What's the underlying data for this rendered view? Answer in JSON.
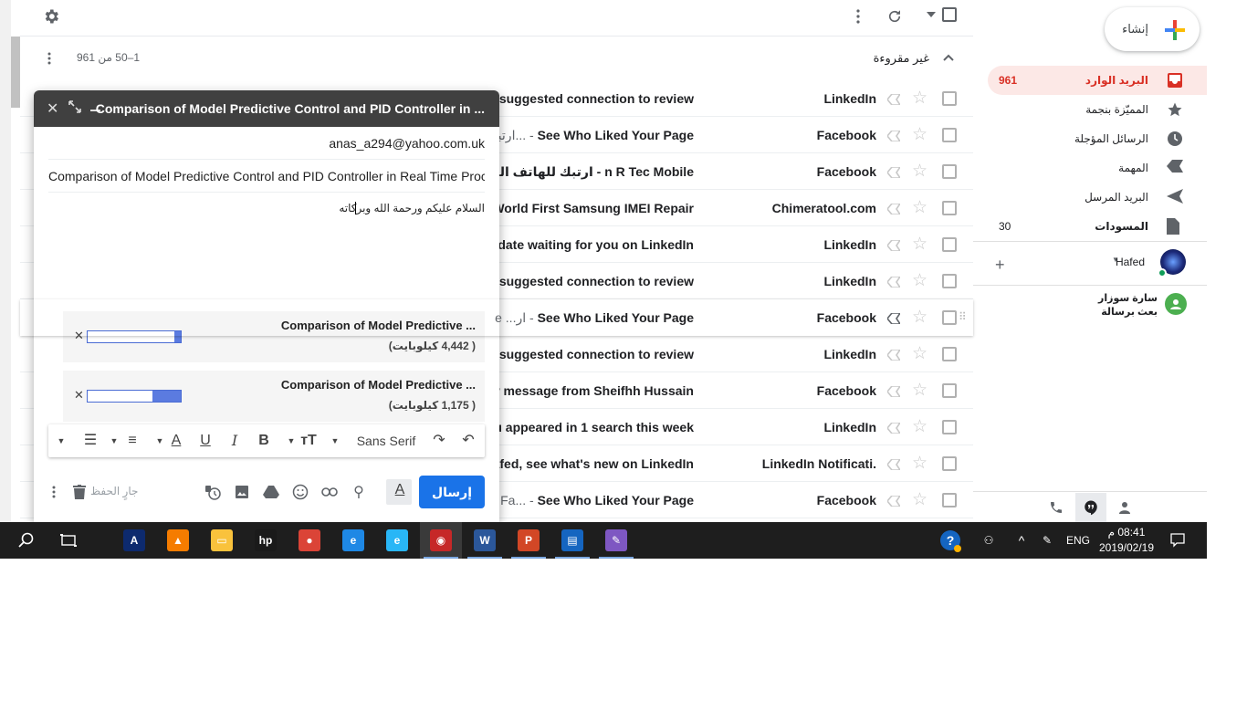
{
  "toolbar": {
    "settings_icon": "gear-icon",
    "more_icon": "more-vert-icon",
    "refresh_icon": "refresh-icon",
    "select_icon": "checkbox-icon"
  },
  "section": {
    "title": "غير مقروءة",
    "pagination": "1–50 من 961"
  },
  "emails": [
    {
      "sender": "LinkedIn",
      "subject": "w suggested connection to review",
      "snippet": ""
    },
    {
      "sender": "Facebook",
      "subject": "See Who Liked Your Page",
      "snippet": "ارتبك لـ... - "
    },
    {
      "sender": "Facebook",
      "subject": "ارتبك للهاتف المحمول - n R Tec Mobile",
      "snippet": ""
    },
    {
      "sender": "Chimeratool.com",
      "subject": "World First Samsung IMEI Repair",
      "snippet": ""
    },
    {
      "sender": "LinkedIn",
      "subject": "pdate waiting for you on LinkedIn",
      "snippet": ""
    },
    {
      "sender": "LinkedIn",
      "subject": "w suggested connection to review",
      "snippet": ""
    },
    {
      "sender": "Facebook",
      "subject": "See Who Liked Your Page",
      "snippet": "e ...ار - "
    },
    {
      "sender": "LinkedIn",
      "subject": "w suggested connection to review",
      "snippet": ""
    },
    {
      "sender": "Facebook",
      "subject": "w message from Sheifhh Hussain",
      "snippet": ""
    },
    {
      "sender": "LinkedIn",
      "subject": "u appeared in 1 search this week",
      "snippet": ""
    },
    {
      "sender": "LinkedIn Notificati.",
      "subject": "afed, see what's new on LinkedIn",
      "snippet": ""
    },
    {
      "sender": "Facebook",
      "subject": "See Who Liked Your Page",
      "snippet": "!ا. Fa... - "
    }
  ],
  "sidebar": {
    "compose_label": "إنشاء",
    "items": [
      {
        "label": "البريد الوارد",
        "count": "961",
        "icon": "inbox-icon"
      },
      {
        "label": "المميّزة بنجمة",
        "count": "",
        "icon": "star-icon"
      },
      {
        "label": "الرسائل المؤجلة",
        "count": "",
        "icon": "clock-icon"
      },
      {
        "label": "المهمة",
        "count": "",
        "icon": "important-icon"
      },
      {
        "label": "البريد المرسل",
        "count": "",
        "icon": "send-icon"
      },
      {
        "label": "المسودات",
        "count": "30",
        "icon": "draft-icon"
      }
    ],
    "hangouts_user": "Hafed",
    "contact_name": "سارة سوزار",
    "contact_status": "بعث برسالة"
  },
  "compose": {
    "title": "Comparison of Model Predictive Control and PID Controller in ...",
    "to": "anas_a294@yahoo.com.uk",
    "subject": "Comparison of Model Predictive Control and PID Controller in Real Time Proc",
    "body": "السلام عليكم ورحمة الله وبركاته",
    "attachments": [
      {
        "name": "Comparison of Model Predictive ...",
        "size": "( 4,442 كيلوبايت)",
        "progress": 0.07
      },
      {
        "name": "Comparison of Model Predictive ...",
        "size": "( 1,175 كيلوبايت)",
        "progress": 0.3
      }
    ],
    "font": "Sans Serif",
    "send_label": "إرسال",
    "saving_label": "جارٍ الحفظ"
  },
  "taskbar": {
    "language": "ENG",
    "time": "08:41 م",
    "date": "2019/02/19",
    "apps": [
      "autodesk-icon",
      "vlc-icon",
      "file-explorer-icon",
      "hp-icon",
      "chrome-icon",
      "edge-icon",
      "ie-icon",
      "app-icon",
      "word-icon",
      "powerpoint-icon",
      "document-icon",
      "paint-icon"
    ]
  }
}
